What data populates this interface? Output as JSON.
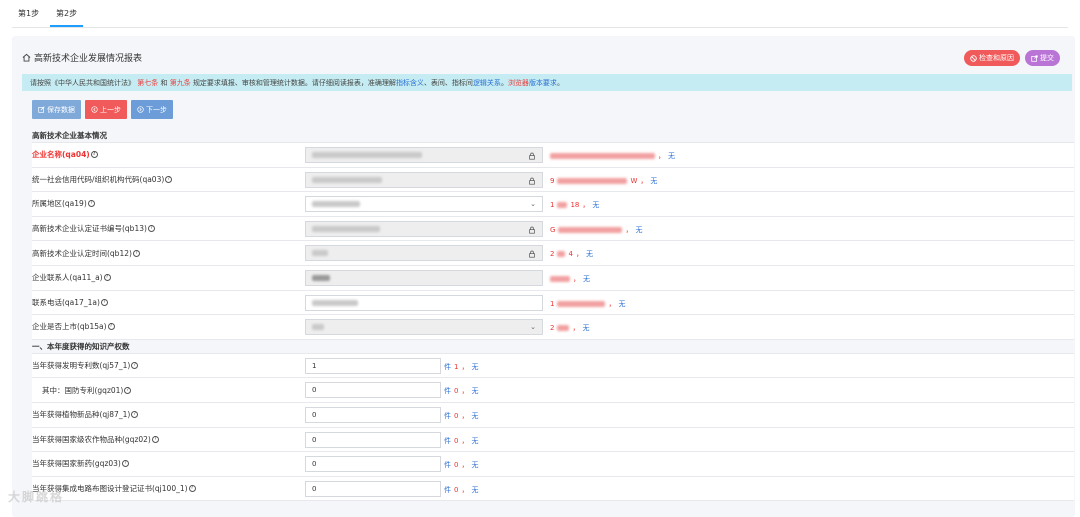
{
  "tabs": [
    {
      "label": "第1步"
    },
    {
      "label": "第2步"
    }
  ],
  "header": {
    "title": "高新技术企业发展情况报表",
    "check_label": "检查和原因",
    "submit_label": "提交"
  },
  "notice": {
    "prefix": "请按照《中华人民共和国统计法》",
    "art7": "第七条",
    "and": "和",
    "art9": "第九条",
    "mid": "规定要求填报、审核和管理统计数据。请仔细阅读报表，准确理解",
    "link1": "指标含义",
    "mid2": "、表间、指标间",
    "link2": "逻辑关系",
    "mid3": "。",
    "link3": "浏览器",
    "link4": "版本要求",
    "suffix": "。"
  },
  "actions": {
    "save": "保存数据",
    "prev": "上一步",
    "next": "下一步"
  },
  "sections": {
    "basic": "高新技术企业基本情况",
    "ip": "一、本年度获得的知识产权数"
  },
  "fields": {
    "qa04": {
      "label": "企业名称(qa04)",
      "ref_suffix": "无"
    },
    "qa03": {
      "label": "统一社会信用代码/组织机构代码(qa03)",
      "ref_prefix": "9",
      "ref_mid": "W",
      "ref_suffix": "无"
    },
    "qa19": {
      "label": "所属地区(qa19)",
      "ref_prefix": "1",
      "ref_mid": "18",
      "ref_suffix": "无"
    },
    "qb13": {
      "label": "高新技术企业认定证书编号(qb13)",
      "ref_prefix": "G",
      "ref_suffix": "无"
    },
    "qb12": {
      "label": "高新技术企业认定时间(qb12)",
      "ref_prefix": "2",
      "ref_mid": "4",
      "ref_suffix": "无"
    },
    "qa11_a": {
      "label": "企业联系人(qa11_a)",
      "ref_suffix": "无"
    },
    "qa17_1a": {
      "label": "联系电话(qa17_1a)",
      "ref_prefix": "1",
      "ref_suffix": "无"
    },
    "qb15a": {
      "label": "企业是否上市(qb15a)",
      "ref_prefix": "2",
      "ref_suffix": "无"
    },
    "qj57_1": {
      "label": "当年获得发明专利数(qj57_1)",
      "value": "1",
      "unit": "件",
      "ref": "1",
      "ref_suffix": "无"
    },
    "gqz01": {
      "label": "其中：国防专利(gqz01)",
      "value": "0",
      "unit": "件",
      "ref": "0",
      "ref_suffix": "无"
    },
    "qj87_1": {
      "label": "当年获得植物新品种(qj87_1)",
      "value": "0",
      "unit": "件",
      "ref": "0",
      "ref_suffix": "无"
    },
    "gqz02": {
      "label": "当年获得国家级农作物品种(gqz02)",
      "value": "0",
      "unit": "件",
      "ref": "0",
      "ref_suffix": "无"
    },
    "gqz03": {
      "label": "当年获得国家新药(gqz03)",
      "value": "0",
      "unit": "件",
      "ref": "0",
      "ref_suffix": "无"
    },
    "qj100_1": {
      "label": "当年获得集成电路布图设计登记证书(qj100_1)",
      "value": "0",
      "unit": "件",
      "ref": "0",
      "ref_suffix": "无"
    }
  },
  "separator": "，",
  "watermark": "大脚跳格",
  "colors": {
    "accent": "#1e9fff",
    "danger": "#f05a5a",
    "notice_bg": "#c5ecf2",
    "link": "#2a6fd6"
  }
}
